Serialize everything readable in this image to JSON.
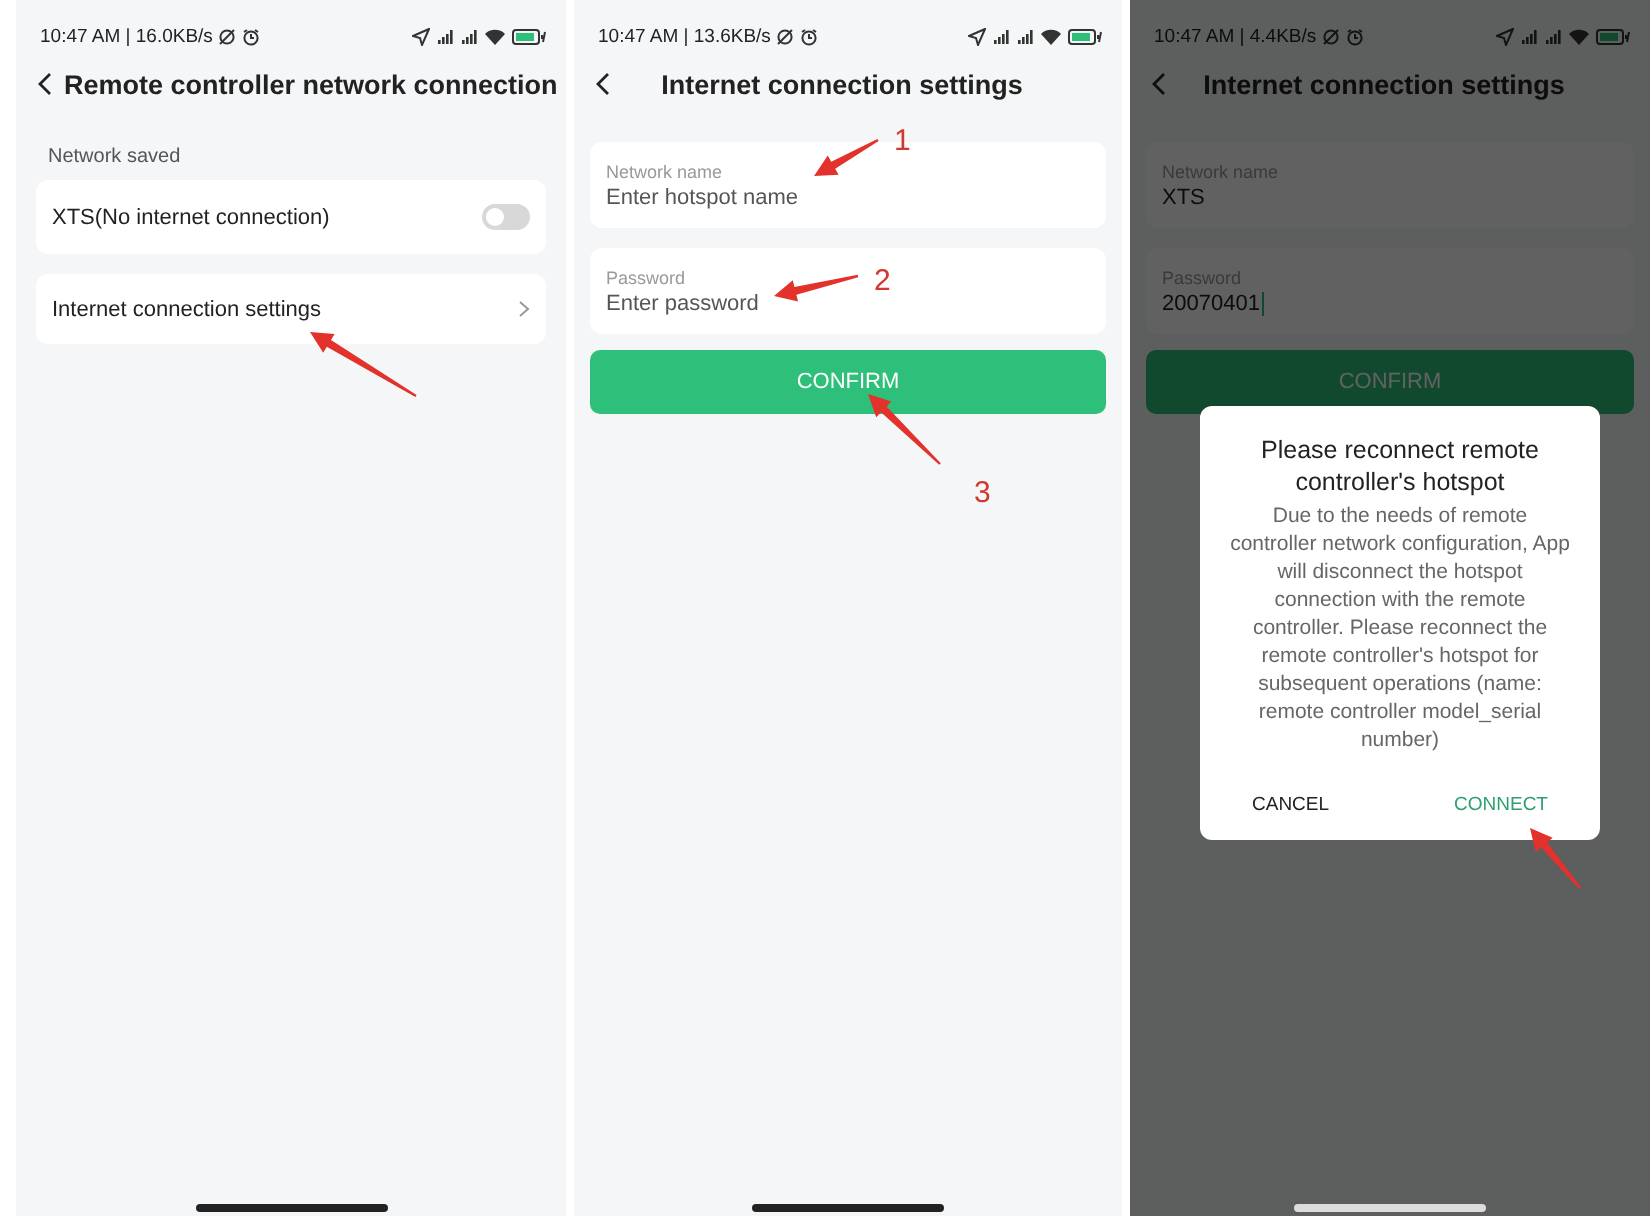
{
  "screens": [
    {
      "kind": "network_list",
      "status_bar": {
        "time": "10:47 AM | 16.0KB/s"
      },
      "title": "Remote controller network connection",
      "section_label": "Network saved",
      "items": [
        {
          "kind": "toggle",
          "label": "XTS(No internet connection)",
          "on": false
        },
        {
          "kind": "link",
          "label": "Internet connection settings"
        }
      ],
      "annotations": [
        {
          "kind": "arrow"
        }
      ]
    },
    {
      "kind": "form",
      "status_bar": {
        "time": "10:47 AM | 13.6KB/s"
      },
      "title": "Internet connection settings",
      "fields": [
        {
          "label": "Network name",
          "placeholder": "Enter hotspot name",
          "focused": false
        },
        {
          "label": "Password",
          "placeholder": "Enter password",
          "focused": false
        }
      ],
      "button": "CONFIRM",
      "annotations": [
        {
          "kind": "numbered",
          "number": "1"
        },
        {
          "kind": "numbered",
          "number": "2"
        },
        {
          "kind": "numbered",
          "number": "3"
        }
      ]
    },
    {
      "kind": "form",
      "status_bar": {
        "time": "10:47 AM | 4.4KB/s"
      },
      "title": "Internet connection settings",
      "fields": [
        {
          "label": "Network name",
          "value": "XTS",
          "focused": false
        },
        {
          "label": "Password",
          "value": "20070401",
          "focused": true
        }
      ],
      "button": "CONFIRM",
      "dialog": {
        "title": "Please reconnect remote controller's hotspot",
        "message": "Due to the needs of remote controller network configuration, App will disconnect the hotspot connection with the remote controller. Please reconnect the remote controller's hotspot for subsequent operations (name: remote controller model_serial number)",
        "buttons": [
          {
            "label": "CANCEL",
            "kind": "secondary"
          },
          {
            "label": "CONNECT",
            "kind": "primary"
          }
        ]
      },
      "annotations": [
        {
          "kind": "arrow"
        }
      ]
    }
  ]
}
